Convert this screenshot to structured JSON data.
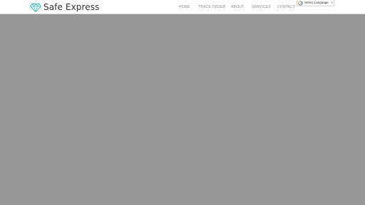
{
  "brand": {
    "name": "Safe Express",
    "logo_icon": "diamond-icon",
    "logo_color": "#3bbfbf"
  },
  "nav": {
    "items": [
      {
        "label": "HOME"
      },
      {
        "label": "TRACK ORDER"
      },
      {
        "label": "ABOUT"
      },
      {
        "label": "SERVICES"
      },
      {
        "label": "CONTACT"
      }
    ]
  },
  "language": {
    "label": "Select Language",
    "icon": "google-g-icon",
    "caret": "▼"
  },
  "colors": {
    "header_bg": "#ffffff",
    "overlay_bg": "#979797",
    "nav_text": "#8a8a8a"
  }
}
